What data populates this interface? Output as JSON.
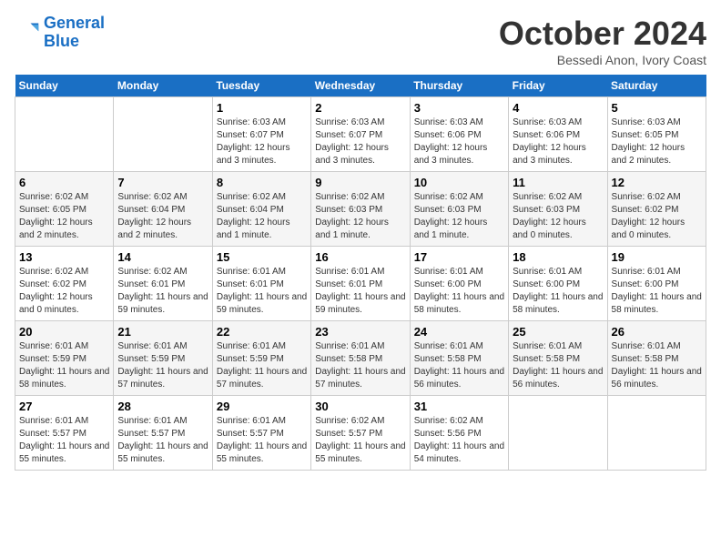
{
  "header": {
    "logo_line1": "General",
    "logo_line2": "Blue",
    "month": "October 2024",
    "location": "Bessedi Anon, Ivory Coast"
  },
  "weekdays": [
    "Sunday",
    "Monday",
    "Tuesday",
    "Wednesday",
    "Thursday",
    "Friday",
    "Saturday"
  ],
  "weeks": [
    [
      {
        "num": "",
        "info": ""
      },
      {
        "num": "",
        "info": ""
      },
      {
        "num": "1",
        "info": "Sunrise: 6:03 AM\nSunset: 6:07 PM\nDaylight: 12 hours and 3 minutes."
      },
      {
        "num": "2",
        "info": "Sunrise: 6:03 AM\nSunset: 6:07 PM\nDaylight: 12 hours and 3 minutes."
      },
      {
        "num": "3",
        "info": "Sunrise: 6:03 AM\nSunset: 6:06 PM\nDaylight: 12 hours and 3 minutes."
      },
      {
        "num": "4",
        "info": "Sunrise: 6:03 AM\nSunset: 6:06 PM\nDaylight: 12 hours and 3 minutes."
      },
      {
        "num": "5",
        "info": "Sunrise: 6:03 AM\nSunset: 6:05 PM\nDaylight: 12 hours and 2 minutes."
      }
    ],
    [
      {
        "num": "6",
        "info": "Sunrise: 6:02 AM\nSunset: 6:05 PM\nDaylight: 12 hours and 2 minutes."
      },
      {
        "num": "7",
        "info": "Sunrise: 6:02 AM\nSunset: 6:04 PM\nDaylight: 12 hours and 2 minutes."
      },
      {
        "num": "8",
        "info": "Sunrise: 6:02 AM\nSunset: 6:04 PM\nDaylight: 12 hours and 1 minute."
      },
      {
        "num": "9",
        "info": "Sunrise: 6:02 AM\nSunset: 6:03 PM\nDaylight: 12 hours and 1 minute."
      },
      {
        "num": "10",
        "info": "Sunrise: 6:02 AM\nSunset: 6:03 PM\nDaylight: 12 hours and 1 minute."
      },
      {
        "num": "11",
        "info": "Sunrise: 6:02 AM\nSunset: 6:03 PM\nDaylight: 12 hours and 0 minutes."
      },
      {
        "num": "12",
        "info": "Sunrise: 6:02 AM\nSunset: 6:02 PM\nDaylight: 12 hours and 0 minutes."
      }
    ],
    [
      {
        "num": "13",
        "info": "Sunrise: 6:02 AM\nSunset: 6:02 PM\nDaylight: 12 hours and 0 minutes."
      },
      {
        "num": "14",
        "info": "Sunrise: 6:02 AM\nSunset: 6:01 PM\nDaylight: 11 hours and 59 minutes."
      },
      {
        "num": "15",
        "info": "Sunrise: 6:01 AM\nSunset: 6:01 PM\nDaylight: 11 hours and 59 minutes."
      },
      {
        "num": "16",
        "info": "Sunrise: 6:01 AM\nSunset: 6:01 PM\nDaylight: 11 hours and 59 minutes."
      },
      {
        "num": "17",
        "info": "Sunrise: 6:01 AM\nSunset: 6:00 PM\nDaylight: 11 hours and 58 minutes."
      },
      {
        "num": "18",
        "info": "Sunrise: 6:01 AM\nSunset: 6:00 PM\nDaylight: 11 hours and 58 minutes."
      },
      {
        "num": "19",
        "info": "Sunrise: 6:01 AM\nSunset: 6:00 PM\nDaylight: 11 hours and 58 minutes."
      }
    ],
    [
      {
        "num": "20",
        "info": "Sunrise: 6:01 AM\nSunset: 5:59 PM\nDaylight: 11 hours and 58 minutes."
      },
      {
        "num": "21",
        "info": "Sunrise: 6:01 AM\nSunset: 5:59 PM\nDaylight: 11 hours and 57 minutes."
      },
      {
        "num": "22",
        "info": "Sunrise: 6:01 AM\nSunset: 5:59 PM\nDaylight: 11 hours and 57 minutes."
      },
      {
        "num": "23",
        "info": "Sunrise: 6:01 AM\nSunset: 5:58 PM\nDaylight: 11 hours and 57 minutes."
      },
      {
        "num": "24",
        "info": "Sunrise: 6:01 AM\nSunset: 5:58 PM\nDaylight: 11 hours and 56 minutes."
      },
      {
        "num": "25",
        "info": "Sunrise: 6:01 AM\nSunset: 5:58 PM\nDaylight: 11 hours and 56 minutes."
      },
      {
        "num": "26",
        "info": "Sunrise: 6:01 AM\nSunset: 5:58 PM\nDaylight: 11 hours and 56 minutes."
      }
    ],
    [
      {
        "num": "27",
        "info": "Sunrise: 6:01 AM\nSunset: 5:57 PM\nDaylight: 11 hours and 55 minutes."
      },
      {
        "num": "28",
        "info": "Sunrise: 6:01 AM\nSunset: 5:57 PM\nDaylight: 11 hours and 55 minutes."
      },
      {
        "num": "29",
        "info": "Sunrise: 6:01 AM\nSunset: 5:57 PM\nDaylight: 11 hours and 55 minutes."
      },
      {
        "num": "30",
        "info": "Sunrise: 6:02 AM\nSunset: 5:57 PM\nDaylight: 11 hours and 55 minutes."
      },
      {
        "num": "31",
        "info": "Sunrise: 6:02 AM\nSunset: 5:56 PM\nDaylight: 11 hours and 54 minutes."
      },
      {
        "num": "",
        "info": ""
      },
      {
        "num": "",
        "info": ""
      }
    ]
  ]
}
